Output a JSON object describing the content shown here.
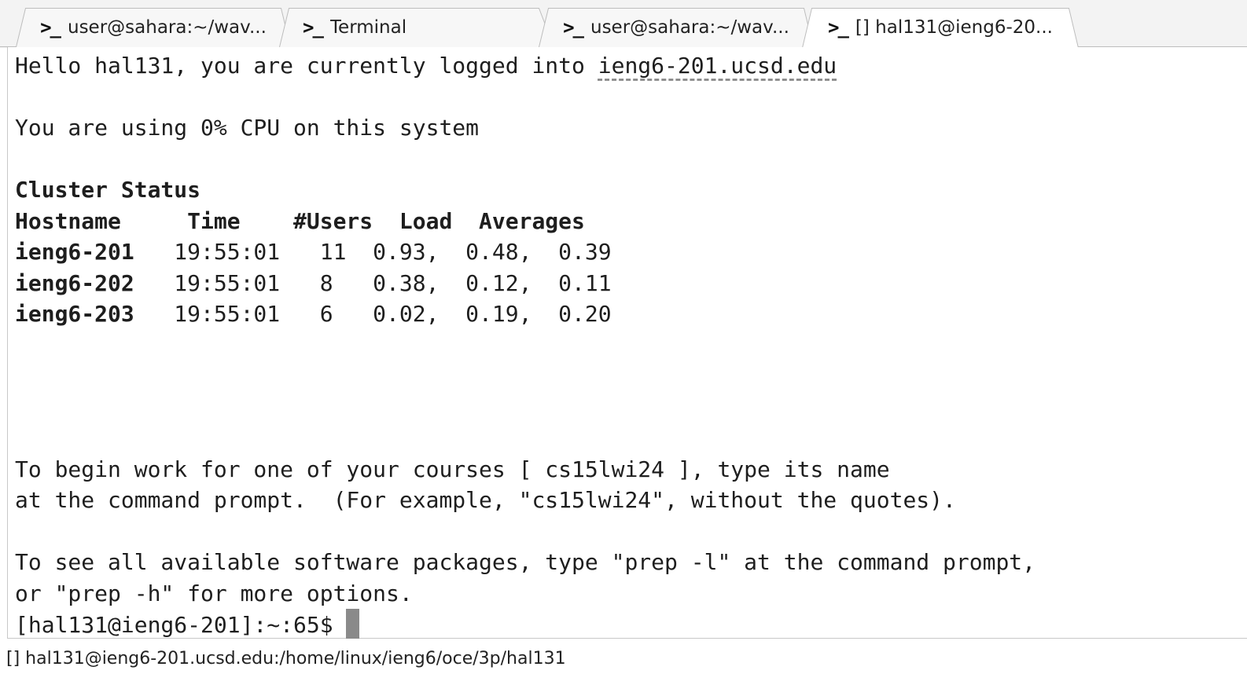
{
  "tabs": [
    {
      "icon": "terminal-prompt-icon",
      "glyph": ">_",
      "label": "user@sahara:~/wav...",
      "active": false
    },
    {
      "icon": "terminal-prompt-icon",
      "glyph": ">_",
      "label": "Terminal",
      "active": false
    },
    {
      "icon": "terminal-prompt-icon",
      "glyph": ">_",
      "label": "user@sahara:~/wav...",
      "active": false
    },
    {
      "icon": "terminal-prompt-icon",
      "glyph": ">_",
      "label": "[] hal131@ieng6-20...",
      "active": true
    }
  ],
  "terminal": {
    "greeting_prefix": "Hello hal131, you are currently logged into ",
    "hostname_link": "ieng6-201.ucsd.edu",
    "cpu_line": "You are using 0% CPU on this system",
    "cluster_title": "Cluster Status",
    "table_header": "Hostname     Time    #Users  Load  Averages",
    "rows": [
      {
        "host": "ieng6-201",
        "rest": "   19:55:01   11  0.93,  0.48,  0.39"
      },
      {
        "host": "ieng6-202",
        "rest": "   19:55:01   8   0.38,  0.12,  0.11"
      },
      {
        "host": "ieng6-203",
        "rest": "   19:55:01   6   0.02,  0.19,  0.20"
      }
    ],
    "courses_line1": "To begin work for one of your courses [ cs15lwi24 ], type its name",
    "courses_line2": "at the command prompt.  (For example, \"cs15lwi24\", without the quotes).",
    "software_line1": "To see all available software packages, type \"prep -l\" at the command prompt,",
    "software_line2": "or \"prep -h\" for more options.",
    "prompt": "[hal131@ieng6-201]:~:65$ "
  },
  "status_bar": "[] hal131@ieng6-201.ucsd.edu:/home/linux/ieng6/oce/3p/hal131",
  "colors": {
    "tab_active_bg": "#ffffff",
    "tab_inactive_bg": "#f7f7f7",
    "tab_border": "#bdbdbd",
    "cursor": "#8a8a8a"
  }
}
